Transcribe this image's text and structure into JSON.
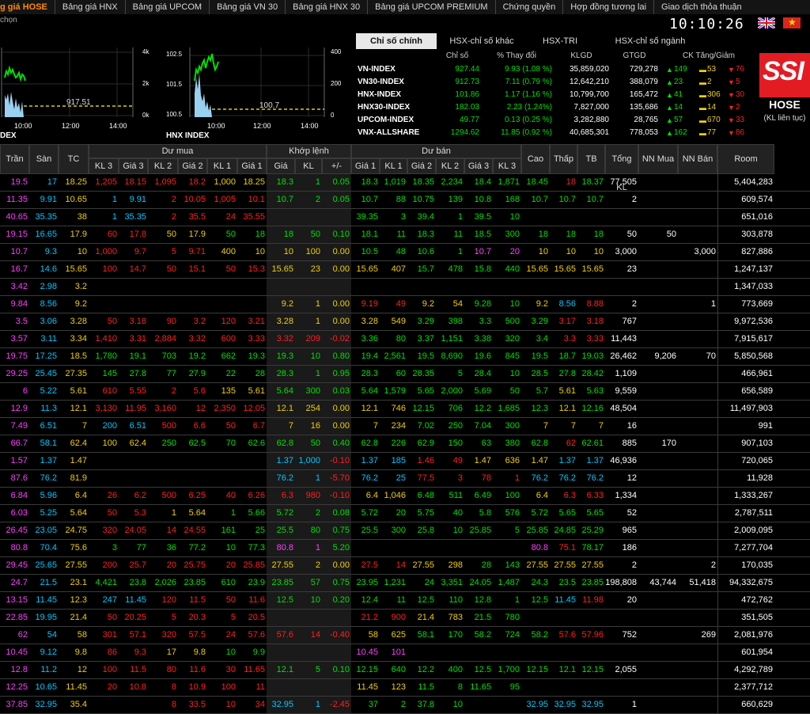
{
  "nav": {
    "items": [
      "g giá HOSE",
      "Bảng giá HNX",
      "Bảng giá UPCOM",
      "Bảng giá VN 30",
      "Bảng giá HNX 30",
      "Bảng giá UPCOM PREMIUM",
      "Chứng quyền",
      "Hợp đồng tương lai",
      "Giao dịch thỏa thuận"
    ],
    "sub_label": "chọn",
    "clock": "10:10:26"
  },
  "charts": [
    {
      "label": "DEX",
      "y_right": [
        "4k",
        "2k",
        "0k"
      ],
      "ref_value": "917.51",
      "x": [
        "10:00",
        "12:00",
        "14:00"
      ]
    },
    {
      "label": "HNX INDEX",
      "y_left": [
        "102.5",
        "101.5",
        "100.5"
      ],
      "y_right": [
        "400",
        "200",
        "0"
      ],
      "ref_value": "100.7",
      "x": [
        "10:00",
        "12:00",
        "14:00"
      ]
    }
  ],
  "index_tabs": [
    "Chỉ số chính",
    "HSX-chỉ số khác",
    "HSX-TRI",
    "HSX-chỉ số ngành"
  ],
  "index_headers": [
    "Chỉ số",
    "% Thay đổi",
    "KLGD",
    "GTGD",
    "CK Tăng/Giảm"
  ],
  "indices": [
    {
      "name": "VN-INDEX",
      "value": "927.44",
      "change": "9.93 (1.08 %)",
      "klgd": "35,859,020",
      "gtgd": "729,278",
      "up": "149",
      "eq": "53",
      "down": "76"
    },
    {
      "name": "VN30-INDEX",
      "value": "912.73",
      "change": "7.11 (0.79 %)",
      "klgd": "12,642,210",
      "gtgd": "388,079",
      "up": "23",
      "eq": "2",
      "down": "5"
    },
    {
      "name": "HNX-INDEX",
      "value": "101.86",
      "change": "1.17 (1.16 %)",
      "klgd": "10,799,700",
      "gtgd": "165,472",
      "up": "41",
      "eq": "306",
      "down": "30"
    },
    {
      "name": "HNX30-INDEX",
      "value": "182.03",
      "change": "2.23 (1.24%)",
      "klgd": "7,827,000",
      "gtgd": "135,686",
      "up": "14",
      "eq": "14",
      "down": "2"
    },
    {
      "name": "UPCOM-INDEX",
      "value": "49.77",
      "change": "0.13 (0.25 %)",
      "klgd": "3,282,880",
      "gtgd": "28,765",
      "up": "57",
      "eq": "670",
      "down": "33"
    },
    {
      "name": "VNX-ALLSHARE",
      "value": "1294.62",
      "change": "11.85 (0.92 %)",
      "klgd": "40,685,301",
      "gtgd": "778,053",
      "up": "162",
      "eq": "77",
      "down": "86"
    }
  ],
  "brand": {
    "logo": "SSI",
    "exchange": "HOSE",
    "note": "(KL liên tục)"
  },
  "board": {
    "group_headers": [
      "Dư mua",
      "Khớp lệnh",
      "Dư bán"
    ],
    "columns": [
      "Trần",
      "Sàn",
      "TC",
      "KL 3",
      "Giá 3",
      "KL 2",
      "Giá 2",
      "KL 1",
      "Giá 1",
      "Giá",
      "KL",
      "+/-",
      "Giá 1",
      "KL 1",
      "Giá 2",
      "KL 2",
      "Giá 3",
      "KL 3",
      "Cao",
      "Thấp",
      "TB",
      "Tổng KL",
      "NN Mua",
      "NN Bán",
      "Room"
    ],
    "rows": [
      [
        "19.5",
        "17",
        "18.25",
        "1,205",
        "18.15",
        "1,095",
        "18.2",
        "1,000",
        "18.25",
        "18.3",
        "1",
        "0.05",
        "18.3",
        "1,019",
        "18.35",
        "2,234",
        "18.4",
        "1,871",
        "18.45",
        "18",
        "18.37",
        "77,505",
        "",
        "",
        "5,404,283"
      ],
      [
        "11.35",
        "9.91",
        "10.65",
        "1",
        "9.91",
        "2",
        "10.05",
        "1,005",
        "10.1",
        "10.7",
        "2",
        "0.05",
        "10.7",
        "88",
        "10.75",
        "139",
        "10.8",
        "168",
        "10.7",
        "10.7",
        "10.7",
        "2",
        "",
        "",
        "609,574"
      ],
      [
        "40.65",
        "35.35",
        "38",
        "1",
        "35.35",
        "2",
        "35.5",
        "24",
        "35.55",
        "",
        "",
        "",
        "39.35",
        "3",
        "39.4",
        "1",
        "39.5",
        "10",
        "",
        "",
        "",
        "",
        "",
        "",
        "651,016"
      ],
      [
        "19.15",
        "16.65",
        "17.9",
        "60",
        "17.8",
        "50",
        "17.9",
        "50",
        "18",
        "18",
        "50",
        "0.10",
        "18.1",
        "11",
        "18.3",
        "11",
        "18.5",
        "300",
        "18",
        "18",
        "18",
        "50",
        "50",
        "",
        "303,878"
      ],
      [
        "10.7",
        "9.3",
        "10",
        "1,000",
        "9.7",
        "5",
        "9.71",
        "400",
        "10",
        "10",
        "100",
        "0.00",
        "10.5",
        "48",
        "10.6",
        "1",
        "10.7",
        "20",
        "10",
        "10",
        "10",
        "3,000",
        "",
        "3,000",
        "827,886"
      ],
      [
        "16.7",
        "14.6",
        "15.65",
        "100",
        "14.7",
        "50",
        "15.1",
        "50",
        "15.3",
        "15.65",
        "23",
        "0.00",
        "15.65",
        "407",
        "15.7",
        "478",
        "15.8",
        "440",
        "15.65",
        "15.65",
        "15.65",
        "23",
        "",
        "",
        "1,247,137"
      ],
      [
        "3.42",
        "2.98",
        "3.2",
        "",
        "",
        "",
        "",
        "",
        "",
        "",
        "",
        "",
        "",
        "",
        "",
        "",
        "",
        "",
        "",
        "",
        "",
        "",
        "",
        "",
        "1,347,033"
      ],
      [
        "9.84",
        "8.56",
        "9.2",
        "",
        "",
        "",
        "",
        "",
        "",
        "9.2",
        "1",
        "0.00",
        "9.19",
        "49",
        "9.2",
        "54",
        "9.28",
        "10",
        "9.2",
        "8.56",
        "8.88",
        "2",
        "",
        "1",
        "773,669"
      ],
      [
        "3.5",
        "3.06",
        "3.28",
        "50",
        "3.18",
        "90",
        "3.2",
        "120",
        "3.21",
        "3.28",
        "1",
        "0.00",
        "3.28",
        "549",
        "3.29",
        "398",
        "3.3",
        "500",
        "3.29",
        "3.17",
        "3.18",
        "767",
        "",
        "",
        "9,972,536"
      ],
      [
        "3.57",
        "3.11",
        "3.34",
        "1,410",
        "3.31",
        "2,884",
        "3.32",
        "600",
        "3.33",
        "3.32",
        "209",
        "-0.02",
        "3.36",
        "80",
        "3.37",
        "1,151",
        "3.38",
        "320",
        "3.4",
        "3.3",
        "3.33",
        "11,443",
        "",
        "",
        "7,915,617"
      ],
      [
        "19.75",
        "17.25",
        "18.5",
        "1,780",
        "19.1",
        "703",
        "19.2",
        "662",
        "19.3",
        "19.3",
        "10",
        "0.80",
        "19.4",
        "2,561",
        "19.5",
        "8,690",
        "19.6",
        "845",
        "19.5",
        "18.7",
        "19.03",
        "26,462",
        "9,206",
        "70",
        "5,850,568"
      ],
      [
        "29.25",
        "25.45",
        "27.35",
        "145",
        "27.8",
        "77",
        "27.9",
        "22",
        "28",
        "28.3",
        "1",
        "0.95",
        "28.3",
        "60",
        "28.35",
        "5",
        "28.4",
        "10",
        "28.5",
        "27.8",
        "28.42",
        "1,109",
        "",
        "",
        "466,961"
      ],
      [
        "6",
        "5.22",
        "5.61",
        "610",
        "5.55",
        "2",
        "5.6",
        "135",
        "5.61",
        "5.64",
        "300",
        "0.03",
        "5.64",
        "1,579",
        "5.65",
        "2,000",
        "5.69",
        "50",
        "5.7",
        "5.61",
        "5.63",
        "9,559",
        "",
        "",
        "656,589"
      ],
      [
        "12.9",
        "11.3",
        "12.1",
        "3,130",
        "11.95",
        "3,160",
        "12",
        "2,350",
        "12.05",
        "12.1",
        "254",
        "0.00",
        "12.1",
        "746",
        "12.15",
        "706",
        "12.2",
        "1,685",
        "12.3",
        "12.1",
        "12.16",
        "48,504",
        "",
        "",
        "11,497,903"
      ],
      [
        "7.49",
        "6.51",
        "7",
        "200",
        "6.51",
        "500",
        "6.6",
        "50",
        "6.7",
        "7",
        "16",
        "0.00",
        "7",
        "234",
        "7.02",
        "250",
        "7.04",
        "300",
        "7",
        "7",
        "7",
        "16",
        "",
        "",
        "991"
      ],
      [
        "66.7",
        "58.1",
        "62.4",
        "100",
        "62.4",
        "250",
        "62.5",
        "70",
        "62.6",
        "62.8",
        "50",
        "0.40",
        "62.8",
        "226",
        "62.9",
        "150",
        "63",
        "380",
        "62.8",
        "62",
        "62.61",
        "885",
        "170",
        "",
        "907,103"
      ],
      [
        "1.57",
        "1.37",
        "1.47",
        "",
        "",
        "",
        "",
        "",
        "",
        "1.37",
        "1,000",
        "-0.10",
        "1.37",
        "185",
        "1.46",
        "49",
        "1.47",
        "636",
        "1.47",
        "1.37",
        "1.37",
        "46,936",
        "",
        "",
        "720,065"
      ],
      [
        "87.6",
        "76.2",
        "81.9",
        "",
        "",
        "",
        "",
        "",
        "",
        "76.2",
        "1",
        "-5.70",
        "76.2",
        "25",
        "77.5",
        "3",
        "78",
        "1",
        "76.2",
        "76.2",
        "76.2",
        "12",
        "",
        "",
        "11,928"
      ],
      [
        "6.84",
        "5.96",
        "6.4",
        "26",
        "6.2",
        "500",
        "6.25",
        "40",
        "6.26",
        "6.3",
        "980",
        "-0.10",
        "6.4",
        "1,046",
        "6.48",
        "511",
        "6.49",
        "100",
        "6.4",
        "6.3",
        "6.33",
        "1,334",
        "",
        "",
        "1,333,267"
      ],
      [
        "6.03",
        "5.25",
        "5.64",
        "50",
        "5.3",
        "1",
        "5.64",
        "1",
        "5.66",
        "5.72",
        "2",
        "0.08",
        "5.72",
        "20",
        "5.75",
        "40",
        "5.8",
        "576",
        "5.72",
        "5.65",
        "5.65",
        "52",
        "",
        "",
        "2,787,511"
      ],
      [
        "26.45",
        "23.05",
        "24.75",
        "320",
        "24.05",
        "14",
        "24.55",
        "161",
        "25",
        "25.5",
        "80",
        "0.75",
        "25.5",
        "300",
        "25.8",
        "10",
        "25.85",
        "5",
        "25.85",
        "24.85",
        "25.29",
        "965",
        "",
        "",
        "2,009,095"
      ],
      [
        "80.8",
        "70.4",
        "75.6",
        "3",
        "77",
        "36",
        "77.2",
        "10",
        "77.3",
        "80.8",
        "1",
        "5.20",
        "",
        "",
        "",
        "",
        "",
        "",
        "80.8",
        "75.1",
        "78.17",
        "186",
        "",
        "",
        "7,277,704"
      ],
      [
        "29.45",
        "25.65",
        "27.55",
        "200",
        "25.7",
        "20",
        "25.75",
        "20",
        "25.85",
        "27.55",
        "2",
        "0.00",
        "27.5",
        "14",
        "27.55",
        "298",
        "28",
        "143",
        "27.55",
        "27.55",
        "27.55",
        "2",
        "",
        "2",
        "170,035"
      ],
      [
        "24.7",
        "21.5",
        "23.1",
        "4,421",
        "23.8",
        "2,026",
        "23.85",
        "610",
        "23.9",
        "23.85",
        "57",
        "0.75",
        "23.95",
        "1,231",
        "24",
        "3,351",
        "24.05",
        "1,487",
        "24.3",
        "23.5",
        "23.85",
        "198,808",
        "43,744",
        "51,418",
        "94,332,675"
      ],
      [
        "13.15",
        "11.45",
        "12.3",
        "247",
        "11.45",
        "120",
        "11.5",
        "50",
        "11.6",
        "12.5",
        "10",
        "0.20",
        "12.4",
        "11",
        "12.5",
        "110",
        "12.8",
        "1",
        "12.5",
        "11.45",
        "11.98",
        "20",
        "",
        "",
        "472,762"
      ],
      [
        "22.85",
        "19.95",
        "21.4",
        "50",
        "20.25",
        "5",
        "20.3",
        "5",
        "20.5",
        "",
        "",
        "",
        "21.2",
        "900",
        "21.4",
        "783",
        "21.5",
        "780",
        "",
        "",
        "",
        "",
        "",
        "",
        "351,505"
      ],
      [
        "62",
        "54",
        "58",
        "301",
        "57.1",
        "320",
        "57.5",
        "24",
        "57.6",
        "57.6",
        "14",
        "-0.40",
        "58",
        "625",
        "58.1",
        "170",
        "58.2",
        "724",
        "58.2",
        "57.6",
        "57.96",
        "752",
        "",
        "269",
        "2,081,976"
      ],
      [
        "10.45",
        "9.12",
        "9.8",
        "86",
        "9.3",
        "17",
        "9.8",
        "10",
        "9.9",
        "",
        "",
        "",
        "10.45",
        "101",
        "",
        "",
        "",
        "",
        "",
        "",
        "",
        "",
        "",
        "",
        "601,954"
      ],
      [
        "12.8",
        "11.2",
        "12",
        "100",
        "11.5",
        "80",
        "11.6",
        "30",
        "11.65",
        "12.1",
        "5",
        "0.10",
        "12.15",
        "640",
        "12.2",
        "400",
        "12.5",
        "1,700",
        "12.15",
        "12.1",
        "12.15",
        "2,055",
        "",
        "",
        "4,292,789"
      ],
      [
        "12.25",
        "10.65",
        "11.45",
        "20",
        "10.8",
        "8",
        "10.9",
        "100",
        "11",
        "",
        "",
        "",
        "11.45",
        "123",
        "11.5",
        "8",
        "11.65",
        "95",
        "",
        "",
        "",
        "",
        "",
        "",
        "2,377,712"
      ],
      [
        "37.85",
        "32.95",
        "35.4",
        "",
        "",
        "8",
        "33.5",
        "10",
        "34",
        "32.95",
        "1",
        "-2.45",
        "37",
        "2",
        "37.8",
        "10",
        "",
        "",
        "32.95",
        "32.95",
        "32.95",
        "1",
        "",
        "",
        "660,629"
      ]
    ]
  }
}
